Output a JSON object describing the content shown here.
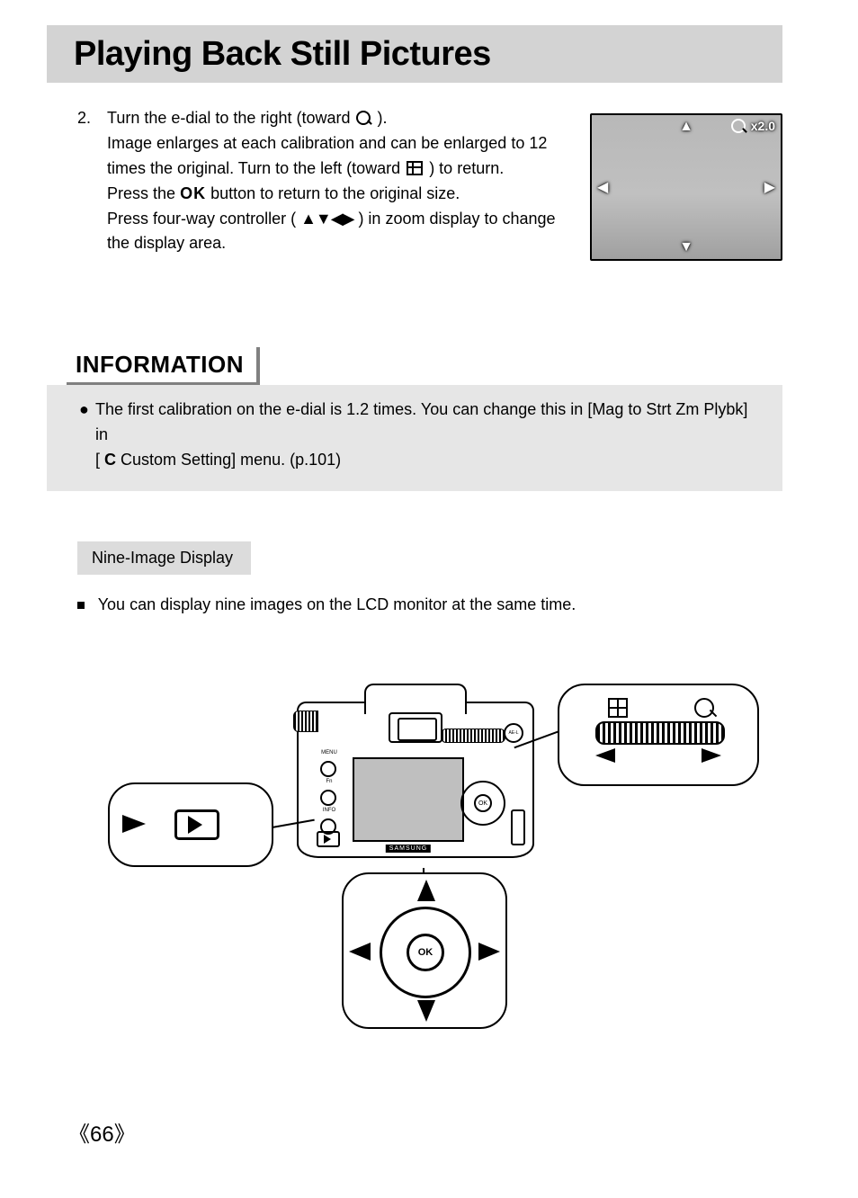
{
  "title": "Playing Back Still Pictures",
  "step": {
    "num": "2.",
    "line1a": "Turn the e-dial to the right (toward ",
    "line1b": " ).",
    "line2": "Image enlarges at each calibration and can be enlarged to 12 times the original. Turn to the left (toward ",
    "line2b": " ) to return.",
    "line3a": "Press the ",
    "ok": "OK",
    "line3b": " button to return to the original size.",
    "line4a": "Press four-way controller (",
    "arrows": "▲▼◀▶",
    "line4b": ") in zoom display to change the display area."
  },
  "zoom_label": "x2.0",
  "info": {
    "heading": "INFORMATION",
    "bullet_a": "The first calibration on the e-dial is 1.2 times. You can change this in [Mag to Strt Zm Plybk] in",
    "bullet_b1": "[ ",
    "c": "C",
    "bullet_b2": " Custom Setting] menu. (p.101)"
  },
  "sub_heading": "Nine-Image Display",
  "sub_text": "You can display nine images on the LCD monitor at the same time.",
  "diagram_labels": {
    "ok": "OK",
    "ael": "AE-L",
    "menu": "MENU",
    "fn": "Fn",
    "info_btn": "INFO"
  },
  "page_number": "66"
}
